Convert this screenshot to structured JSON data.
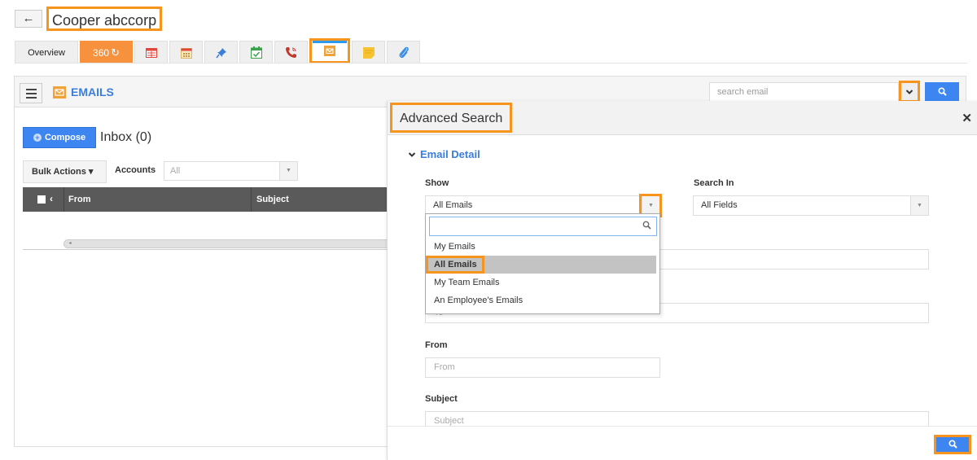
{
  "header": {
    "back_icon": "arrow-left-icon",
    "back_glyph": "←",
    "contact_name": "Cooper abccorp"
  },
  "tabs": [
    {
      "label": "Overview",
      "icon": null
    },
    {
      "label": "360",
      "icon": "refresh-icon",
      "glyph": "↻"
    },
    {
      "label": "",
      "icon": "activity-table-icon"
    },
    {
      "label": "",
      "icon": "calendar-icon"
    },
    {
      "label": "",
      "icon": "pin-icon"
    },
    {
      "label": "",
      "icon": "task-check-icon"
    },
    {
      "label": "",
      "icon": "phone-call-icon"
    },
    {
      "label": "",
      "icon": "email-icon",
      "active": true
    },
    {
      "label": "",
      "icon": "sticky-note-icon"
    },
    {
      "label": "",
      "icon": "paperclip-icon"
    }
  ],
  "emails_panel": {
    "title": "EMAILS",
    "search_placeholder": "search email",
    "adv_toggle_glyph": "⌄",
    "search_glyph": "⚲",
    "compose_label": "Compose",
    "compose_plus": "+",
    "inbox_label": "Inbox (0)",
    "bulk_actions_label": "Bulk Actions ▾",
    "accounts_label": "Accounts",
    "accounts_value": "All",
    "arrow_glyph": "▼",
    "columns": [
      "From",
      "Subject"
    ],
    "chevron_glyph": "‹",
    "scroll_left_glyph": "◂"
  },
  "advanced_search": {
    "title": "Advanced Search",
    "close_glyph": "✕",
    "section_label": "Email Detail",
    "section_chevron": "⌄",
    "show_label": "Show",
    "show_value": "All Emails",
    "search_in_label": "Search In",
    "search_in_value": "All Fields",
    "to_placeholder": "To",
    "from_label": "From",
    "from_placeholder": "From",
    "subject_label": "Subject",
    "subject_placeholder": "Subject",
    "search_button_glyph": "⚲",
    "dropdown": {
      "search_glyph": "⚲",
      "options": [
        "My Emails",
        "All Emails",
        "My Team Emails",
        "An Employee's Emails"
      ],
      "selected": "All Emails"
    }
  },
  "colors": {
    "highlight": "#f7941d",
    "accent_blue": "#3d86f2",
    "title_blue": "#3b7ddd",
    "tab_360": "#f7913d"
  }
}
